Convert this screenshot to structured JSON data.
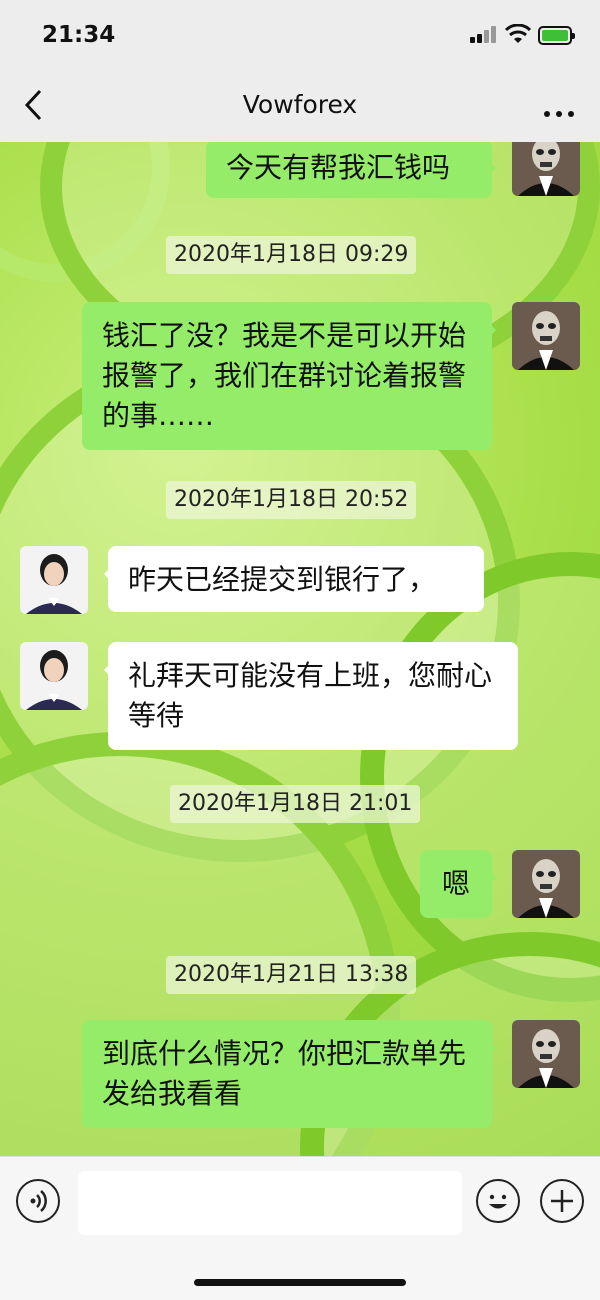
{
  "status_bar": {
    "time": "21:34"
  },
  "nav": {
    "title": "Vowforex",
    "back_icon": "chevron-left-icon",
    "more_icon": "more-dots-icon"
  },
  "messages": [
    {
      "sender": "me",
      "text": "今天有帮我汇钱吗"
    },
    {
      "type": "timestamp",
      "text": "2020年1月18日 09:29"
    },
    {
      "sender": "me",
      "text": "钱汇了没？我是不是可以开始报警了，我们在群讨论着报警的事……"
    },
    {
      "type": "timestamp",
      "text": "2020年1月18日 20:52"
    },
    {
      "sender": "them",
      "text": "昨天已经提交到银行了，"
    },
    {
      "sender": "them",
      "text": "礼拜天可能没有上班，您耐心等待"
    },
    {
      "type": "timestamp",
      "text": "2020年1月18日 21:01"
    },
    {
      "sender": "me",
      "text": "嗯"
    },
    {
      "type": "timestamp",
      "text": "2020年1月21日 13:38"
    },
    {
      "sender": "me",
      "text": "到底什么情况？你把汇款单先发给我看看"
    }
  ],
  "input_bar": {
    "message_value": "",
    "voice_icon": "voice-icon",
    "emoji_icon": "emoji-icon",
    "plus_icon": "plus-icon"
  },
  "colors": {
    "my_bubble": "#95ec69",
    "their_bubble": "#ffffff",
    "bar_bg": "#ededed"
  }
}
